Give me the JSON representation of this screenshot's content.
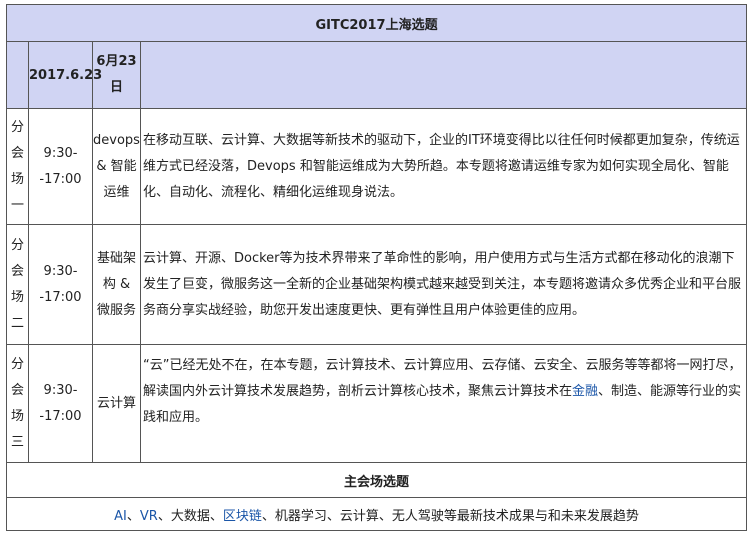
{
  "title": "GITC2017上海选题",
  "date_header": {
    "date": "2017.6.23",
    "day": "6月23日"
  },
  "sessions": [
    {
      "hall_chars": [
        "分",
        "会",
        "场",
        "一"
      ],
      "time_start": "9:30-",
      "time_end": "-17:00",
      "topic_lines": [
        "devops",
        "& 智能",
        "运维"
      ],
      "description": "在移动互联、云计算、大数据等新技术的驱动下，企业的IT环境变得比以往任何时候都更加复杂，传统运维方式已经没落，Devops 和智能运维成为大势所趋。本专题将邀请运维专家为如何实现全局化、智能化、自动化、流程化、精细化运维现身说法。"
    },
    {
      "hall_chars": [
        "分",
        "会",
        "场",
        "二"
      ],
      "time_start": "9:30-",
      "time_end": "-17:00",
      "topic_lines": [
        "基础架",
        "构 &",
        "微服务"
      ],
      "description": "云计算、开源、Docker等为技术界带来了革命性的影响，用户使用方式与生活方式都在移动化的浪潮下发生了巨变，微服务这一全新的企业基础架构模式越来越受到关注，本专题将邀请众多优秀企业和平台服务商分享实战经验，助您开发出速度更快、更有弹性且用户体验更佳的应用。"
    },
    {
      "hall_chars": [
        "分",
        "会",
        "场",
        "三"
      ],
      "time_start": "9:30-",
      "time_end": "-17:00",
      "topic_lines": [
        "云计算"
      ],
      "description_pre": "“云”已经无处不在，在本专题，云计算技术、云计算应用、云存储、云安全、云服务等等都将一网打尽，解读国内外云计算技术发展趋势，剖析云计算核心技术，聚焦云计算技术在",
      "description_link": "金融",
      "description_post": "、制造、能源等行业的实践和应用。"
    }
  ],
  "main_hall": {
    "title": "主会场选题",
    "topics": [
      {
        "text": "AI",
        "link": true
      },
      {
        "text": "、",
        "link": false
      },
      {
        "text": "VR",
        "link": true
      },
      {
        "text": "、大数据、",
        "link": false
      },
      {
        "text": "区块链",
        "link": true
      },
      {
        "text": "、机器学习、云计算、无人驾驶等最新技术成果与和未来发展趋势",
        "link": false
      }
    ]
  },
  "colors": {
    "header_bg": "#d0d4f3",
    "link": "#1b56a8",
    "border": "#555555"
  }
}
